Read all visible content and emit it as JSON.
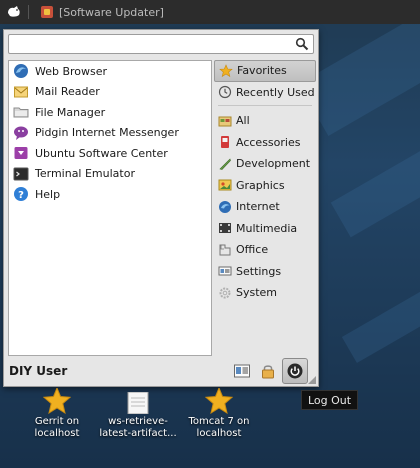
{
  "panel": {
    "task_title": "[Software Updater]"
  },
  "search": {
    "value": "",
    "placeholder": ""
  },
  "apps": [
    {
      "label": "Web Browser",
      "icon": "web-browser-icon"
    },
    {
      "label": "Mail Reader",
      "icon": "mail-icon"
    },
    {
      "label": "File Manager",
      "icon": "folder-icon"
    },
    {
      "label": "Pidgin Internet Messenger",
      "icon": "pidgin-icon"
    },
    {
      "label": "Ubuntu Software Center",
      "icon": "software-center-icon"
    },
    {
      "label": "Terminal Emulator",
      "icon": "terminal-icon"
    },
    {
      "label": "Help",
      "icon": "help-icon"
    }
  ],
  "categories": [
    {
      "label": "Favorites",
      "icon": "star-icon",
      "active": true
    },
    {
      "label": "Recently Used",
      "icon": "clock-icon"
    },
    {
      "label": "All",
      "icon": "all-icon"
    },
    {
      "label": "Accessories",
      "icon": "accessories-icon"
    },
    {
      "label": "Development",
      "icon": "development-icon"
    },
    {
      "label": "Graphics",
      "icon": "graphics-icon"
    },
    {
      "label": "Internet",
      "icon": "internet-icon"
    },
    {
      "label": "Multimedia",
      "icon": "multimedia-icon"
    },
    {
      "label": "Office",
      "icon": "office-icon"
    },
    {
      "label": "Settings",
      "icon": "settings-icon"
    },
    {
      "label": "System",
      "icon": "system-icon"
    }
  ],
  "user": {
    "name": "DIY User"
  },
  "tooltip": {
    "text": "Log Out"
  },
  "desktop_icons": [
    {
      "line1": "Gerrit on",
      "line2": "localhost",
      "icon": "star-bookmark-icon"
    },
    {
      "line1": "ws-retrieve-",
      "line2": "latest-artifact...",
      "icon": "document-icon"
    },
    {
      "line1": "Tomcat 7 on",
      "line2": "localhost",
      "icon": "star-bookmark-icon"
    }
  ],
  "colors": {
    "panel_bg": "#2c2c2c",
    "menu_bg": "#e6e6e6",
    "desktop_bg": "#1f3a52",
    "favorite_star": "#f0b020"
  }
}
